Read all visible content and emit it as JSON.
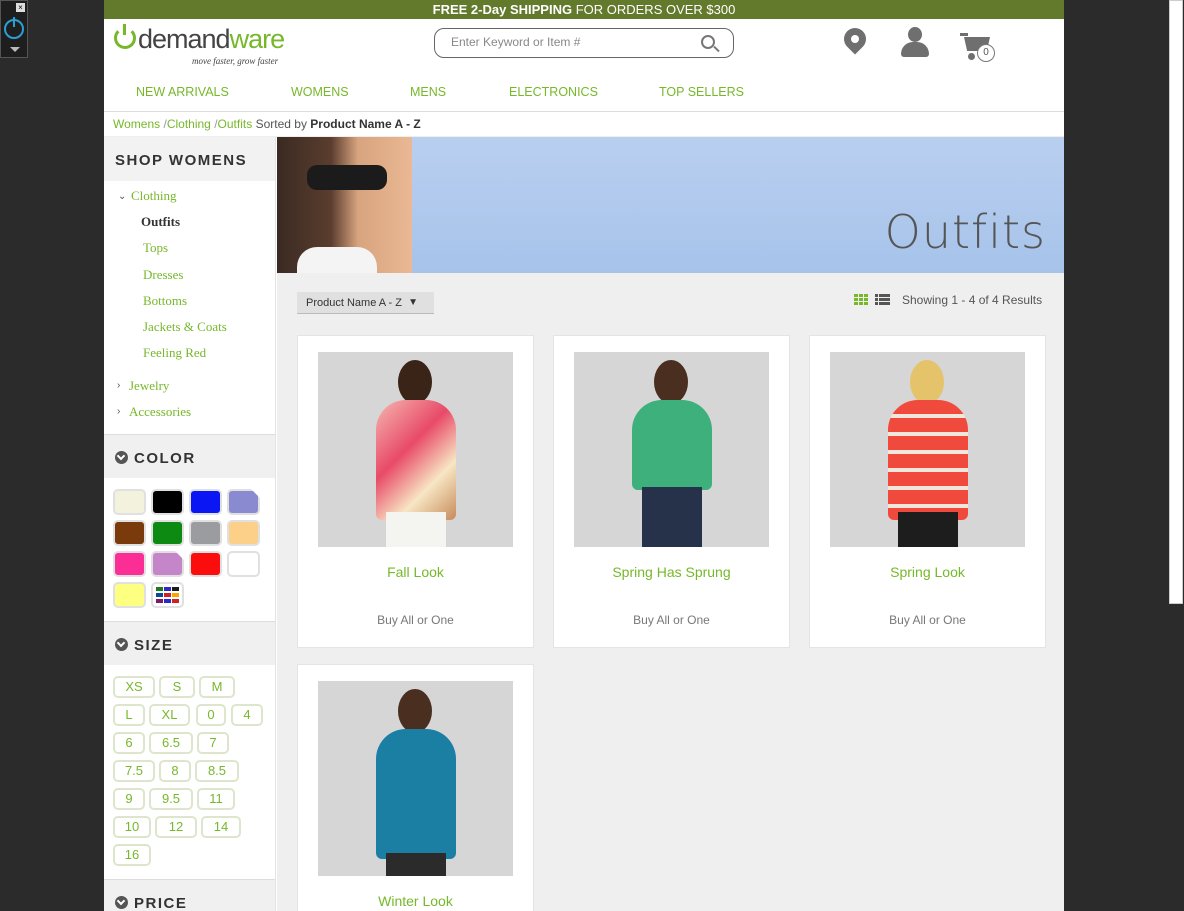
{
  "promo": {
    "bold1": "FREE 2-Day SHIPPING",
    "rest": " FOR ORDERS OVER $300"
  },
  "logo": {
    "brand_a": "demand",
    "brand_b": "ware",
    "tagline": "move faster, grow faster"
  },
  "search": {
    "placeholder": "Enter Keyword or Item #"
  },
  "cart": {
    "count": "0"
  },
  "nav": [
    "NEW ARRIVALS",
    "WOMENS",
    "MENS",
    "ELECTRONICS",
    "TOP SELLERS"
  ],
  "breadcrumb": {
    "items": [
      "Womens",
      "Clothing",
      "Outfits"
    ],
    "sorted_prefix": "Sorted by ",
    "sorted_value": "Product Name A - Z"
  },
  "sidebar": {
    "heading": "SHOP WOMENS",
    "parent": "Clothing",
    "children": [
      "Outfits",
      "Tops",
      "Dresses",
      "Bottoms",
      "Jackets & Coats",
      "Feeling Red"
    ],
    "others": [
      "Jewelry",
      "Accessories"
    ]
  },
  "facets": {
    "color_label": "COLOR",
    "colors": [
      "#f3f3dd",
      "#000000",
      "#0b16f5",
      "#8a8ad0",
      "#7a3a0b",
      "#0d8a12",
      "#9a9ca0",
      "#fdd089",
      "#fa2e95",
      "#c585c9",
      "#fb0d0d",
      "#ffffff",
      "#fdff80",
      "miscellaneous"
    ],
    "size_label": "SIZE",
    "sizes": [
      "XS",
      "S",
      "M",
      "L",
      "XL",
      "0",
      "4",
      "6",
      "6.5",
      "7",
      "7.5",
      "8",
      "8.5",
      "9",
      "9.5",
      "11",
      "10",
      "12",
      "14",
      "16"
    ],
    "price_label": "PRICE"
  },
  "banner": {
    "title": "Outfits"
  },
  "toolbar": {
    "sort_value": "Product Name A - Z",
    "results": "Showing 1 - 4 of 4 Results"
  },
  "products": [
    {
      "name": "Fall Look",
      "buy": "Buy All or One"
    },
    {
      "name": "Spring Has Sprung",
      "buy": "Buy All or One"
    },
    {
      "name": "Spring Look",
      "buy": "Buy All or One"
    },
    {
      "name": "Winter Look",
      "buy": "Buy All or One"
    }
  ],
  "accent_color": "#76b82a"
}
